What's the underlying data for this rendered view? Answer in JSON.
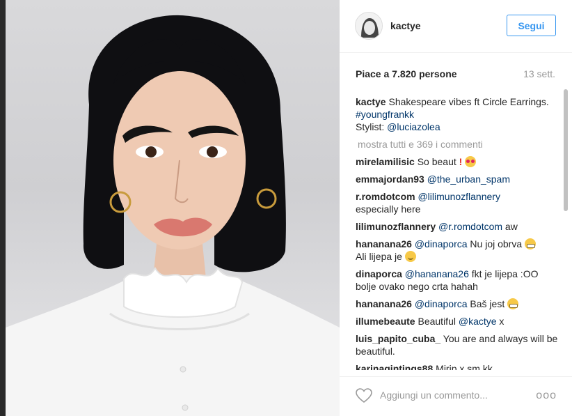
{
  "post": {
    "photo_icon": "portrait-photo",
    "author": "kactye",
    "follow_label": "Segui",
    "likes": "Piace a 7.820 persone",
    "time": "13 sett.",
    "caption": {
      "user": "kactye",
      "text_1": "Shakespeare vibes ft Circle Earrings. ",
      "hashtag": "#youngfrankk",
      "text_2": "Stylist: ",
      "mention": "@luciazolea"
    },
    "show_all": "mostra tutti e 369 i commenti",
    "comments": [
      {
        "user": "mirelamilisic",
        "text": "So beaut ",
        "emoji": [
          "exclamation-icon",
          "heart-eyes-icon"
        ]
      },
      {
        "user": "emmajordan93",
        "mention": "@the_urban_spam",
        "text": ""
      },
      {
        "user": "r.romdotcom",
        "mention": "@lilimunozflannery",
        "text": "especially here"
      },
      {
        "user": "lilimunozflannery",
        "mention": "@r.romdotcom",
        "text": " aw"
      },
      {
        "user": "hananana26",
        "mention": "@dinaporca",
        "text": " Nu joj obrva ",
        "text_2": "Ali lijepa je "
      },
      {
        "user": "dinaporca",
        "mention": "@hananana26",
        "text": " fkt je lijepa :OO bolje ovako nego crta hahah"
      },
      {
        "user": "hananana26",
        "mention": "@dinaporca",
        "text": " Baš jest "
      },
      {
        "user": "illumebeaute",
        "text": "Beautiful ",
        "mention": "@kactye",
        "text_after": " x"
      },
      {
        "user": "luis_papito_cuba_",
        "text": "You are and always will be beautiful."
      },
      {
        "user": "karinagintings88",
        "text": "Mirip x sm kk"
      }
    ],
    "comment_placeholder": "Aggiungi un commento...",
    "more_label": "ooo"
  },
  "colors": {
    "link": "#003569",
    "accent": "#3897f0",
    "muted": "#999999"
  }
}
